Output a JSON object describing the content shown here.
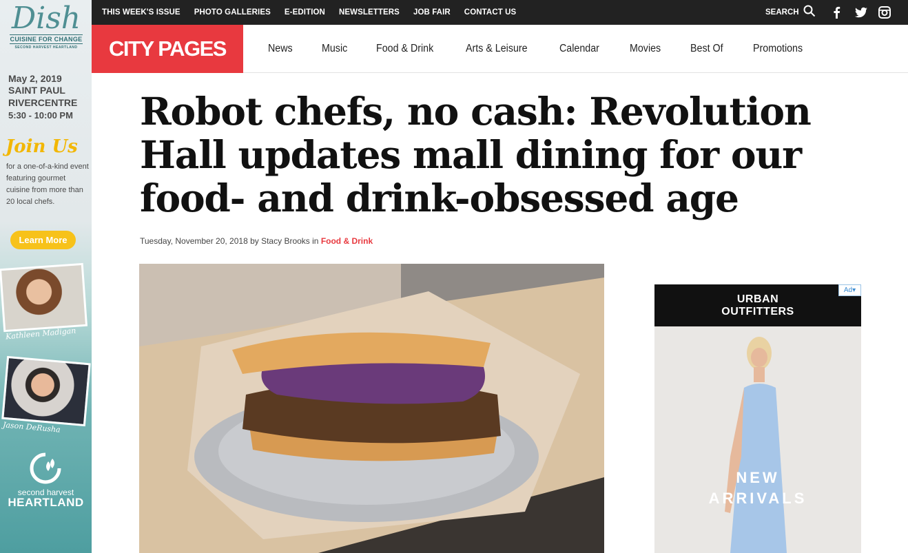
{
  "side_ad": {
    "logo_script": "Dish",
    "logo_line1": "CUISINE FOR CHANGE",
    "logo_line2": "SECOND HARVEST HEARTLAND",
    "date": "May 2, 2019",
    "city": "SAINT PAUL",
    "venue": "RIVERCENTRE",
    "time": "5:30 - 10:00 PM",
    "join": "Join Us",
    "join_text": "for a one-of-a-kind event featuring gourmet cuisine from more than 20 local chefs.",
    "cta": "Learn More",
    "sig1": "Kathleen Madigan",
    "sig2": "Jason DeRusha",
    "org_small": "second harvest",
    "org_big": "HEARTLAND"
  },
  "topbar": {
    "links": [
      "THIS WEEK'S ISSUE",
      "PHOTO GALLERIES",
      "E-EDITION",
      "NEWSLETTERS",
      "JOB FAIR",
      "CONTACT US"
    ],
    "search_label": "SEARCH",
    "icons": [
      "search-icon",
      "facebook-icon",
      "twitter-icon",
      "instagram-icon"
    ]
  },
  "nav": {
    "brand": "CITY PAGES",
    "items": [
      "News",
      "Music",
      "Food & Drink",
      "Arts & Leisure",
      "Calendar",
      "Movies",
      "Best Of",
      "Promotions"
    ]
  },
  "article": {
    "headline": "Robot chefs, no cash: Revolution Hall updates mall dining for our food- and drink-obsessed age",
    "byline_prefix": "Tuesday, November 20, 2018 by Stacy Brooks in",
    "category": "Food & Drink"
  },
  "right_ad": {
    "brand_line1": "URBAN",
    "brand_line2": "OUTFITTERS",
    "ad_badge": "Ad",
    "promo_line1": "NEW",
    "promo_line2": "ARRIVALS"
  },
  "colors": {
    "brand_red": "#e8393f",
    "topbar": "#222222",
    "cta_yellow": "#f7c21a"
  }
}
